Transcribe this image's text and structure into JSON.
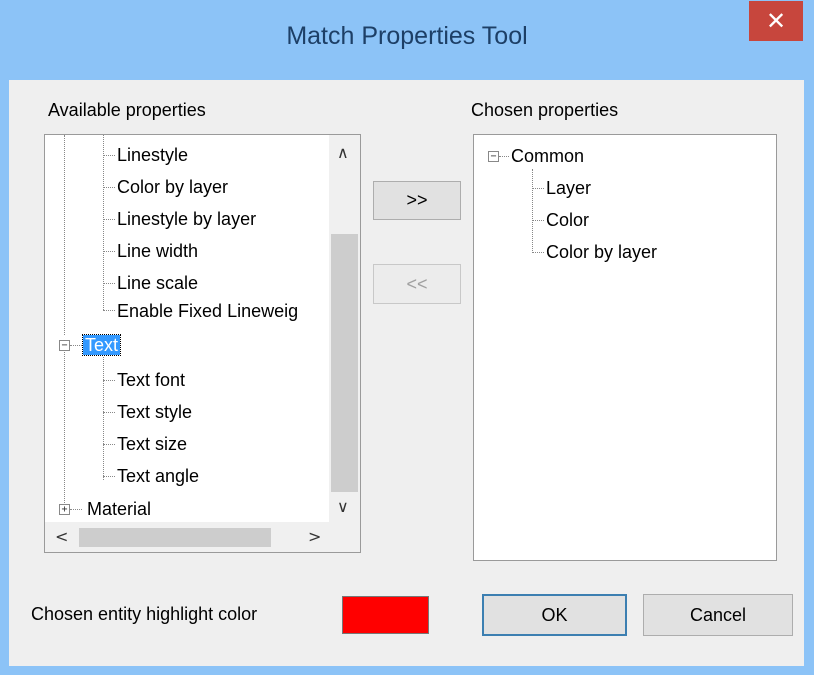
{
  "window": {
    "title": "Match Properties Tool",
    "close_icon": "✕"
  },
  "available": {
    "label": "Available properties",
    "items": [
      "Linestyle",
      "Color by layer",
      "Linestyle by layer",
      "Line width",
      "Line scale",
      "Enable Fixed Lineweig",
      "Text",
      "Text font",
      "Text style",
      "Text size",
      "Text angle",
      "Material"
    ],
    "scroll_up": "∧",
    "scroll_down": "∨",
    "scroll_left": "<",
    "scroll_right": ">"
  },
  "buttons": {
    "add_label": ">>",
    "remove_label": "<<",
    "ok_label": "OK",
    "cancel_label": "Cancel"
  },
  "chosen": {
    "label": "Chosen properties",
    "items": [
      "Common",
      "Layer",
      "Color",
      "Color by layer"
    ]
  },
  "highlight": {
    "label": "Chosen entity highlight color",
    "color": "#ff0000"
  }
}
